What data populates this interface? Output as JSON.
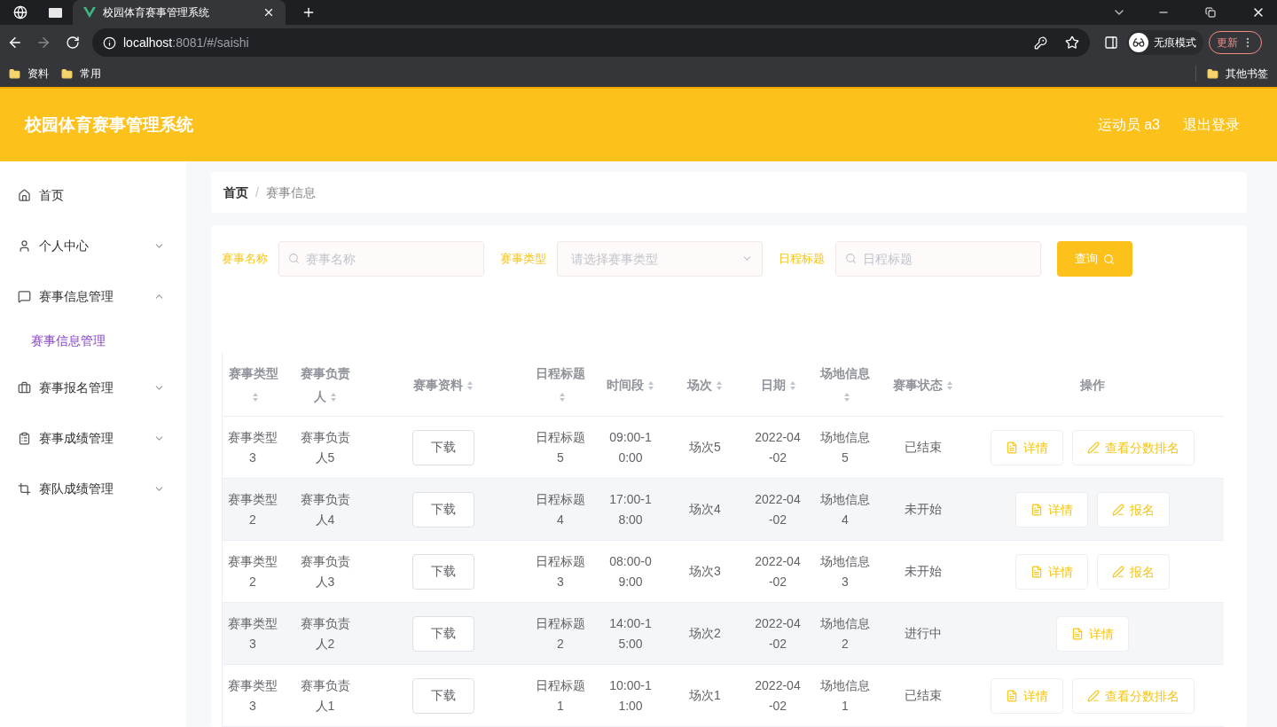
{
  "browser": {
    "tab_title": "校园体育赛事管理系统",
    "url_host": "localhost",
    "url_rest": ":8081/#/saishi",
    "incognito": "无痕模式",
    "update": "更新",
    "bookmarks": [
      "资料",
      "常用"
    ],
    "other_bookmarks": "其他书签"
  },
  "header": {
    "title": "校园体育赛事管理系统",
    "user": "运动员 a3",
    "logout": "退出登录"
  },
  "sidebar": {
    "items": [
      {
        "label": "首页"
      },
      {
        "label": "个人中心",
        "expanded": false
      },
      {
        "label": "赛事信息管理",
        "expanded": true,
        "children": [
          {
            "label": "赛事信息管理",
            "selected": true
          }
        ]
      },
      {
        "label": "赛事报名管理",
        "expanded": false
      },
      {
        "label": "赛事成绩管理",
        "expanded": false
      },
      {
        "label": "赛队成绩管理",
        "expanded": false
      }
    ]
  },
  "breadcrumb": [
    "首页",
    "赛事信息"
  ],
  "breadcrumb_separator": "/",
  "filters": [
    {
      "label": "赛事名称",
      "kind": "input",
      "placeholder": "赛事名称"
    },
    {
      "label": "赛事类型",
      "kind": "select",
      "placeholder": "请选择赛事类型"
    },
    {
      "label": "日程标题",
      "kind": "input",
      "placeholder": "日程标题"
    }
  ],
  "search_button": "查询",
  "table": {
    "columns": [
      {
        "label": "赛事类型",
        "sortable": true
      },
      {
        "label": "赛事负责人",
        "sortable": true
      },
      {
        "label": "赛事资料",
        "sortable": true
      },
      {
        "label": "日程标题",
        "sortable": true
      },
      {
        "label": "时间段",
        "sortable": true
      },
      {
        "label": "场次",
        "sortable": true
      },
      {
        "label": "日期",
        "sortable": true
      },
      {
        "label": "场地信息",
        "sortable": true
      },
      {
        "label": "赛事状态",
        "sortable": true
      },
      {
        "label": "操作",
        "sortable": false
      }
    ],
    "rows": [
      {
        "cells": [
          "赛事类型3",
          "赛事负责人5",
          "下载",
          "日程标题5",
          "09:00-10:00",
          "场次5",
          "2022-04-02",
          "场地信息5",
          "已结束"
        ],
        "actions": [
          {
            "label": "详情",
            "kind": "detail"
          },
          {
            "label": "查看分数排名",
            "kind": "score"
          }
        ]
      },
      {
        "cells": [
          "赛事类型2",
          "赛事负责人4",
          "下载",
          "日程标题4",
          "17:00-18:00",
          "场次4",
          "2022-04-02",
          "场地信息4",
          "未开始"
        ],
        "actions": [
          {
            "label": "详情",
            "kind": "detail"
          },
          {
            "label": "报名",
            "kind": "signup"
          }
        ]
      },
      {
        "cells": [
          "赛事类型2",
          "赛事负责人3",
          "下载",
          "日程标题3",
          "08:00-09:00",
          "场次3",
          "2022-04-02",
          "场地信息3",
          "未开始"
        ],
        "actions": [
          {
            "label": "详情",
            "kind": "detail"
          },
          {
            "label": "报名",
            "kind": "signup"
          }
        ]
      },
      {
        "cells": [
          "赛事类型3",
          "赛事负责人2",
          "下载",
          "日程标题2",
          "14:00-15:00",
          "场次2",
          "2022-04-02",
          "场地信息2",
          "进行中"
        ],
        "actions": [
          {
            "label": "详情",
            "kind": "detail"
          }
        ]
      },
      {
        "cells": [
          "赛事类型3",
          "赛事负责人1",
          "下载",
          "日程标题1",
          "10:00-11:00",
          "场次1",
          "2022-04-02",
          "场地信息1",
          "已结束"
        ],
        "actions": [
          {
            "label": "详情",
            "kind": "detail"
          },
          {
            "label": "查看分数排名",
            "kind": "score"
          }
        ]
      }
    ]
  }
}
